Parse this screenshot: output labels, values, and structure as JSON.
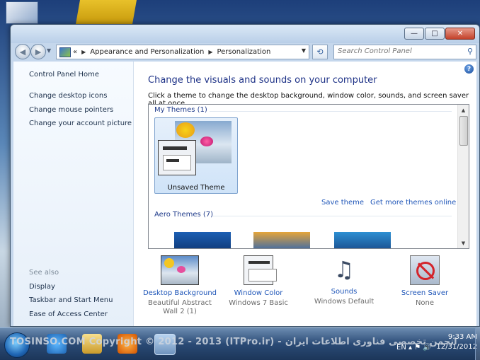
{
  "window": {
    "address": {
      "overflow": "«",
      "crumbs": [
        "Appearance and Personalization",
        "Personalization"
      ]
    },
    "search_placeholder": "Search Control Panel",
    "caption_buttons": {
      "minimize": "—",
      "maximize": "□",
      "close": "✕"
    }
  },
  "left_pane": {
    "home": "Control Panel Home",
    "links": [
      "Change desktop icons",
      "Change mouse pointers",
      "Change your account picture"
    ],
    "see_also_title": "See also",
    "see_also": [
      "Display",
      "Taskbar and Start Menu",
      "Ease of Access Center"
    ]
  },
  "main": {
    "heading": "Change the visuals and sounds on your computer",
    "subheading": "Click a theme to change the desktop background, window color, sounds, and screen saver all at once.",
    "my_themes_label": "My Themes (1)",
    "unsaved_theme": "Unsaved Theme",
    "save_theme": "Save theme",
    "get_more_online": "Get more themes online",
    "aero_themes_label": "Aero Themes (7)"
  },
  "bottom_items": [
    {
      "title": "Desktop Background",
      "value": "Beautiful Abstract Wall 2 (1)",
      "icon": "desktop-background-icon"
    },
    {
      "title": "Window Color",
      "value": "Windows 7 Basic",
      "icon": "window-color-icon"
    },
    {
      "title": "Sounds",
      "value": "Windows Default",
      "icon": "sounds-icon"
    },
    {
      "title": "Screen Saver",
      "value": "None",
      "icon": "screen-saver-icon"
    }
  ],
  "taskbar": {
    "watermark": "TOSINSO.COM Copyright © 2012 - 2013 (ITPro.ir) - انجمن تخصصی فناوری اطلاعات ایران",
    "time": "9:33 AM",
    "date": "12/31/2012",
    "tray_language": "EN"
  }
}
